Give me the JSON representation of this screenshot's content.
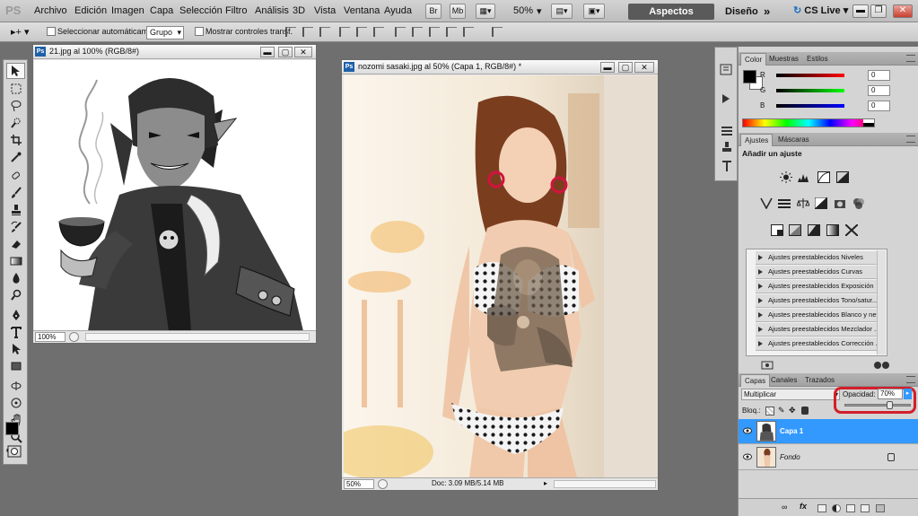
{
  "app": {
    "logo": "PS"
  },
  "menubar": {
    "items": [
      "Archivo",
      "Edición",
      "Imagen",
      "Capa",
      "Selección",
      "Filtro",
      "Análisis",
      "3D",
      "Vista",
      "Ventana",
      "Ayuda"
    ],
    "bridge": "Br",
    "minibridge": "Mb",
    "zoom": "50%",
    "workspace_active": "Aspectos esenciales",
    "workspace_other": "Diseño",
    "more": "»",
    "cslive": "CS Live"
  },
  "options": {
    "auto_select_label": "Seleccionar automáticamente:",
    "auto_select_value": "Grupo",
    "transform_label": "Mostrar controles transf."
  },
  "docs": {
    "doc1": {
      "title": "21.jpg al 100% (RGB/8#)",
      "zoom": "100%"
    },
    "doc2": {
      "title": "nozomi sasaki.jpg al 50% (Capa 1, RGB/8#) *",
      "zoom": "50%",
      "docsize": "Doc: 3.09 MB/5.14 MB"
    }
  },
  "color_panel": {
    "tabs": [
      "Color",
      "Muestras",
      "Estilos"
    ],
    "channels": [
      {
        "label": "R",
        "value": "0"
      },
      {
        "label": "G",
        "value": "0"
      },
      {
        "label": "B",
        "value": "0"
      }
    ]
  },
  "adjust_panel": {
    "tabs": [
      "Ajustes",
      "Máscaras"
    ],
    "heading": "Añadir un ajuste",
    "presets": [
      "Ajustes preestablecidos Niveles",
      "Ajustes preestablecidos Curvas",
      "Ajustes preestablecidos Exposición",
      "Ajustes preestablecidos Tono/satur...",
      "Ajustes preestablecidos Blanco y ne...",
      "Ajustes preestablecidos Mezclador ...",
      "Ajustes preestablecidos Corrección ..."
    ]
  },
  "layers_panel": {
    "tabs": [
      "Capas",
      "Canales",
      "Trazados"
    ],
    "blend_mode": "Multiplicar",
    "opacity_label": "Opacidad:",
    "opacity_value": "70%",
    "opacity": 0.7,
    "lock_label": "Bloq.:",
    "layers": [
      {
        "name": "Capa 1",
        "selected": true
      },
      {
        "name": "Fondo",
        "selected": false,
        "locked": true
      }
    ]
  },
  "colors": {
    "accent": "#3399ff",
    "highlight_box": "#d21f2b",
    "ws_active": "#5a5a5a"
  }
}
